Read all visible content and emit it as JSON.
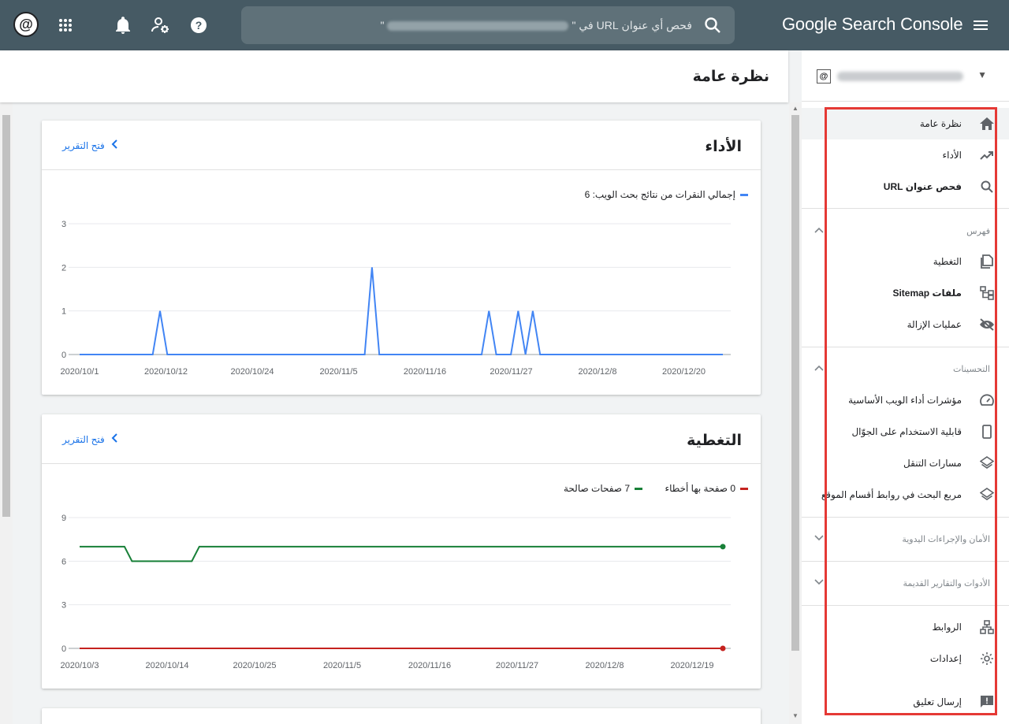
{
  "topbar": {
    "brand": "Google Search Console",
    "search_prefix": "فحص أي عنوان URL في \"",
    "search_suffix": "\"",
    "search_url": "https://••••••••••••.blogspot.com/",
    "avatar_symbol": "@"
  },
  "header": {
    "title": "نظرة عامة"
  },
  "property": {
    "symbol": "@",
    "url": "https://•••••••.blogspot.com/"
  },
  "sidebar": {
    "items_top": [
      {
        "label": "نظرة عامة",
        "icon": "home-icon"
      },
      {
        "label": "الأداء",
        "icon": "trending-up-icon"
      },
      {
        "label": "فحص عنوان URL",
        "icon": "search-icon"
      }
    ],
    "section_index": "فهرس",
    "items_index": [
      {
        "label": "التغطية",
        "icon": "file-copy-icon"
      },
      {
        "label": "ملفات Sitemap",
        "icon": "sitemap-icon"
      },
      {
        "label": "عمليات الإزالة",
        "icon": "visibility-off-icon"
      }
    ],
    "section_enhancements": "التحسينات",
    "items_enhancements": [
      {
        "label": "مؤشرات أداء الويب الأساسية",
        "icon": "speed-gauge-icon"
      },
      {
        "label": "قابلية الاستخدام على الجوّال",
        "icon": "smartphone-icon"
      },
      {
        "label": "مسارات التنقل",
        "icon": "layers-icon"
      },
      {
        "label": "مربع البحث في روابط أقسام الموقع",
        "icon": "layers-icon"
      }
    ],
    "section_security": "الأمان والإجراءات اليدوية",
    "section_legacy": "الأدوات والتقارير القديمة",
    "items_bottom": [
      {
        "label": "الروابط",
        "icon": "links-network-icon"
      },
      {
        "label": "إعدادات",
        "icon": "settings-gear-icon"
      }
    ],
    "feedback": "إرسال تعليق"
  },
  "performance_card": {
    "title": "الأداء",
    "open_report": "فتح التقرير",
    "legend": "إجمالي النقرات من نتائج بحث الويب: 6",
    "series_color": "#4285f4"
  },
  "coverage_card": {
    "title": "التغطية",
    "open_report": "فتح التقرير",
    "legend_errors": "0 صفحة بها أخطاء",
    "legend_valid": "7 صفحات صالحة",
    "errors_color": "#c5221f",
    "valid_color": "#188038"
  },
  "chart_data": [
    {
      "type": "line",
      "title": "الأداء",
      "ylim": [
        0,
        3
      ],
      "yticks": [
        "0",
        "1",
        "2",
        "3"
      ],
      "xtick_labels": [
        "2020/10/1",
        "2020/10/12",
        "2020/10/24",
        "2020/11/5",
        "2020/11/16",
        "2020/11/27",
        "2020/12/8",
        "2020/12/20"
      ],
      "grid": true,
      "series": [
        {
          "name": "إجمالي النقرات من نتائج بحث الويب",
          "x_start": "2020/10/1",
          "x_end": "2020/12/28",
          "points": [
            {
              "x": "2020/10/1",
              "y": 0
            },
            {
              "x": "2020/10/12",
              "y": 1
            },
            {
              "x": "2020/11/10",
              "y": 2
            },
            {
              "x": "2020/11/26",
              "y": 1
            },
            {
              "x": "2020/11/30",
              "y": 1
            },
            {
              "x": "2020/12/2",
              "y": 1
            },
            {
              "x": "2020/12/28",
              "y": 0
            }
          ]
        }
      ]
    },
    {
      "type": "line",
      "title": "التغطية",
      "ylim": [
        0,
        9
      ],
      "yticks": [
        "0",
        "3",
        "6",
        "9"
      ],
      "xtick_labels": [
        "2020/10/3",
        "2020/10/14",
        "2020/10/25",
        "2020/11/5",
        "2020/11/16",
        "2020/11/27",
        "2020/12/8",
        "2020/12/19"
      ],
      "grid": true,
      "series": [
        {
          "name": "صفحات صالحة",
          "points": [
            {
              "x": "2020/10/3",
              "y": 7
            },
            {
              "x": "2020/10/9",
              "y": 7
            },
            {
              "x": "2020/10/10",
              "y": 6
            },
            {
              "x": "2020/10/18",
              "y": 6
            },
            {
              "x": "2020/10/19",
              "y": 7
            },
            {
              "x": "2020/12/28",
              "y": 7
            }
          ]
        },
        {
          "name": "صفحة بها أخطاء",
          "points": [
            {
              "x": "2020/10/3",
              "y": 0
            },
            {
              "x": "2020/12/28",
              "y": 0
            }
          ]
        }
      ]
    }
  ]
}
